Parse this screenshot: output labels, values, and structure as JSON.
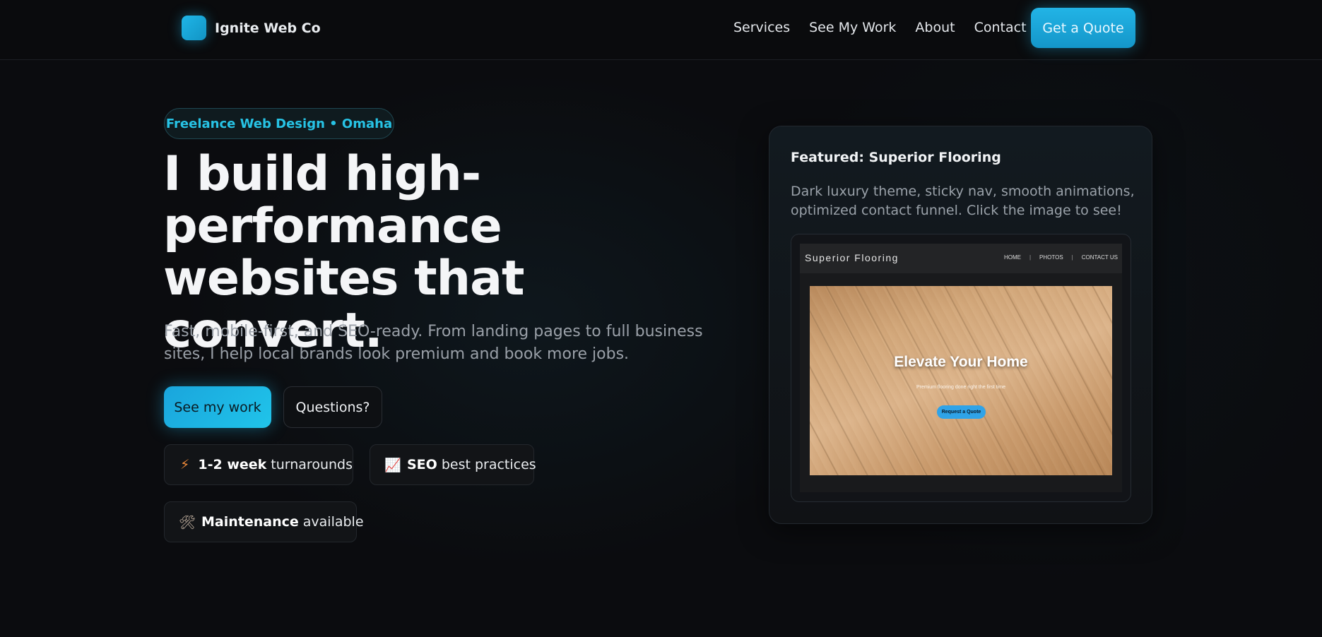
{
  "nav": {
    "brand": "Ignite Web Co",
    "links": [
      "Services",
      "See My Work",
      "About",
      "Contact"
    ],
    "cta": "Get a Quote"
  },
  "hero": {
    "pill": "Freelance Web Design • Omaha",
    "headline": "I build high-performance websites that convert.",
    "subcopy": "Fast, mobile-first, and SEO-ready. From landing pages to full business sites, I help local brands look premium and book more jobs.",
    "primary_button": "See my work",
    "secondary_button": "Questions?",
    "chips": [
      {
        "icon": "lightning-icon",
        "glyph": "⚡",
        "bold": "1-2 week",
        "text": "turnarounds"
      },
      {
        "icon": "chart-increasing-icon",
        "glyph": "📈",
        "bold": "SEO",
        "text": "best practices"
      },
      {
        "icon": "tools-icon",
        "glyph": "🛠",
        "bold": "Maintenance",
        "text": "available"
      }
    ]
  },
  "featured": {
    "title": "Featured: Superior Flooring",
    "description": "Dark luxury theme, sticky nav, smooth animations, optimized contact funnel. Click the image to see!",
    "preview": {
      "brand": "Superior Flooring",
      "links": [
        "HOME",
        "PHOTOS",
        "CONTACT US"
      ],
      "separator": "|",
      "hero_title": "Elevate Your Home",
      "hero_subtitle": "Premium flooring done right the first time",
      "hero_button": "Request a Quote"
    }
  },
  "colors": {
    "background": "#0b0c0f",
    "accent": "#1fb6e8",
    "pill_text": "#27c3e5",
    "muted_text": "#9aa0a8"
  }
}
